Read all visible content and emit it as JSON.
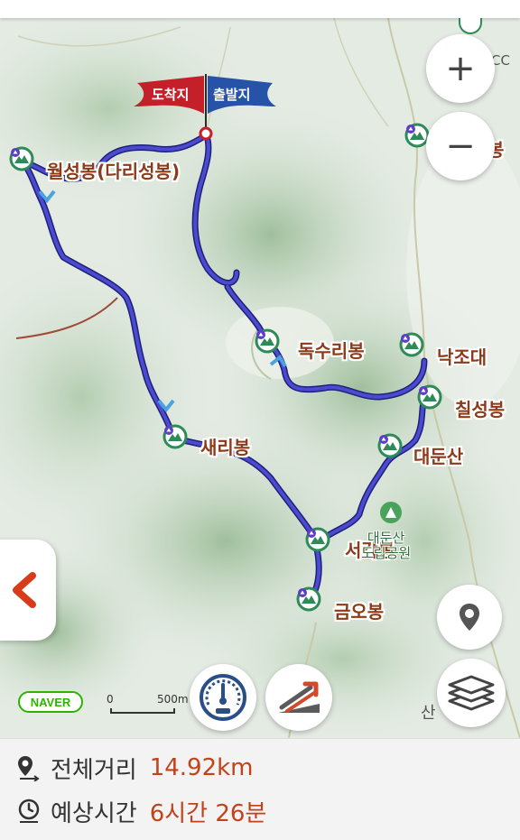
{
  "map": {
    "flag_left": "도착지",
    "flag_right": "출발지",
    "peaks": [
      {
        "name": "월성봉(다리성봉)"
      },
      {
        "name": "독수리봉"
      },
      {
        "name": "낙조대"
      },
      {
        "name": "칠성봉"
      },
      {
        "name": "대둔산"
      },
      {
        "name": "새리봉"
      },
      {
        "name": "서각봉"
      },
      {
        "name": "금오봉"
      }
    ],
    "park_label": "대둔산\n도립공원",
    "corner_labels": {
      "top_right": "CC",
      "right_partial": "봉",
      "bottom_right": "산"
    },
    "brand": "NAVER",
    "scale": {
      "zero": "0",
      "distance": "500m"
    },
    "colors": {
      "route": "#3a3ab8",
      "flag_left": "#c4202a",
      "flag_right": "#2653a8",
      "accent": "#c2421a"
    }
  },
  "controls": {
    "zoom_in": "+",
    "zoom_out": "−",
    "icons": [
      "zoom-in-icon",
      "zoom-out-icon",
      "back-icon",
      "location-pin-icon",
      "layers-icon",
      "speedometer-icon",
      "elevation-profile-icon"
    ]
  },
  "info": {
    "distance_label": "전체거리",
    "distance_value": "14.92km",
    "time_label": "예상시간",
    "time_value": "6시간 26분"
  }
}
